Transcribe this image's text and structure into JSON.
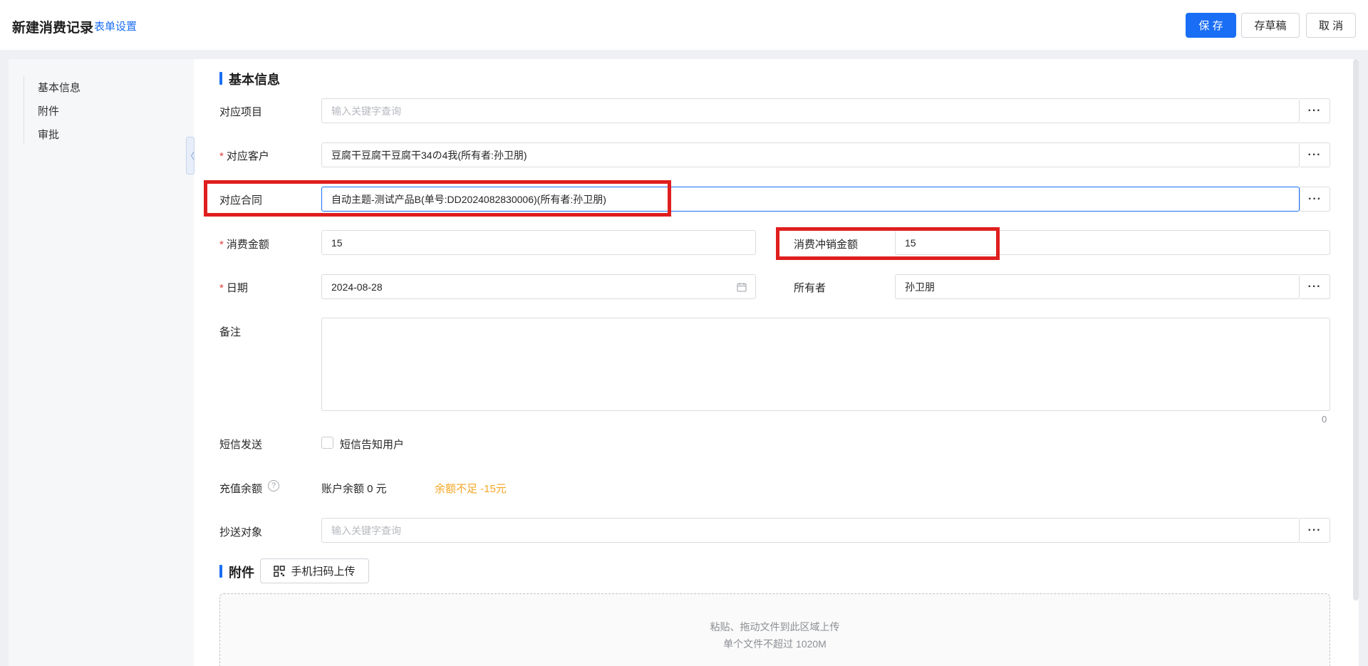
{
  "header": {
    "title": "新建消费记录",
    "form_settings": "表单设置",
    "save": "保 存",
    "draft": "存草稿",
    "cancel": "取 消"
  },
  "nav": {
    "items": [
      "基本信息",
      "附件",
      "审批"
    ]
  },
  "basic_info": {
    "section_title": "基本信息",
    "project": {
      "label": "对应项目",
      "placeholder": "输入关键字查询"
    },
    "customer": {
      "label": "对应客户",
      "value": "豆腐干豆腐干豆腐干34の4我(所有者:孙卫朋)"
    },
    "contract": {
      "label": "对应合同",
      "value": "自动主题-测试产品B(单号:DD2024082830006)(所有者:孙卫朋)"
    },
    "amount": {
      "label": "消费金额",
      "value": "15"
    },
    "offset_amount": {
      "label": "消费冲销金额",
      "value": "15"
    },
    "date": {
      "label": "日期",
      "value": "2024-08-28"
    },
    "owner": {
      "label": "所有者",
      "value": "孙卫朋"
    },
    "remark": {
      "label": "备注",
      "count": "0"
    },
    "sms": {
      "label": "短信发送",
      "option": "短信告知用户"
    },
    "balance": {
      "label": "充值余额",
      "account": "账户余额 0 元",
      "warning": "余额不足 -15元"
    },
    "cc": {
      "label": "抄送对象",
      "placeholder": "输入关键字查询"
    }
  },
  "attachments": {
    "section_title": "附件",
    "scan_upload": "手机扫码上传",
    "drop_hint": "粘贴、拖动文件到此区域上传",
    "size_hint": "单个文件不超过 1020M"
  },
  "colors": {
    "primary": "#1a6ef5",
    "required": "#e23b3b",
    "warning": "#f5a623",
    "highlight": "#e01e1e"
  }
}
